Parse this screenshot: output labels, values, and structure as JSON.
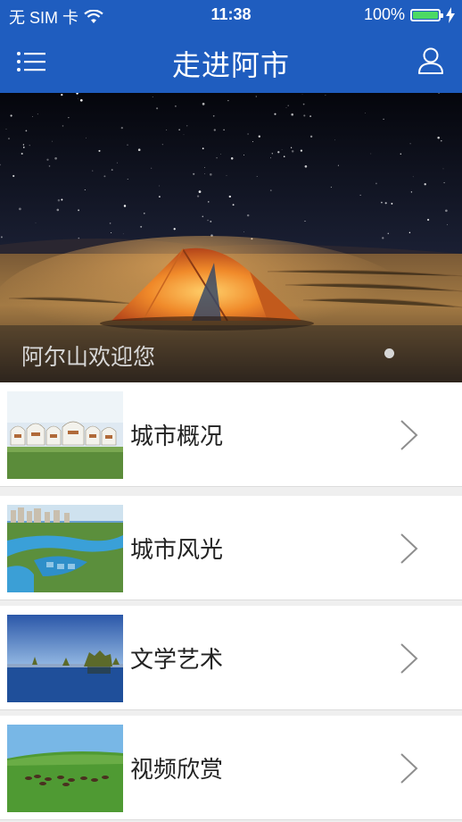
{
  "status_bar": {
    "carrier": "无 SIM 卡",
    "time": "11:38",
    "battery": "100%",
    "battery_level": 1.0,
    "wifi_icon": "wifi-icon",
    "charging_icon": "bolt-icon"
  },
  "nav": {
    "title": "走进阿市",
    "menu_icon": "list-menu-icon",
    "user_icon": "user-icon"
  },
  "banner": {
    "caption": "阿尔山欢迎您",
    "page_count": 1,
    "current_page": 1
  },
  "list": {
    "items": [
      {
        "label": "城市概况",
        "thumb": "yurt-camp-thumbnail"
      },
      {
        "label": "城市风光",
        "thumb": "city-river-thumbnail"
      },
      {
        "label": "文学艺术",
        "thumb": "lake-reeds-thumbnail"
      },
      {
        "label": "视频欣赏",
        "thumb": "grassland-herd-thumbnail"
      }
    ]
  },
  "colors": {
    "brand_blue": "#1f5dbf",
    "battery_green": "#4cd964",
    "row_bg": "#ffffff",
    "separator": "#efefef"
  }
}
